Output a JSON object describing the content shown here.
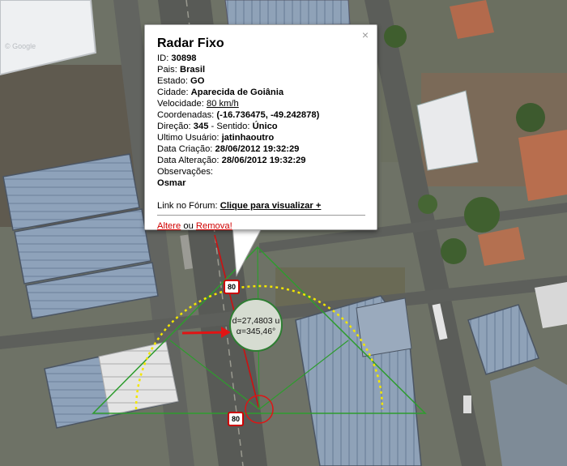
{
  "popup": {
    "title": "Radar Fixo",
    "close": "×",
    "rows": [
      {
        "label": "ID: ",
        "value": "30898"
      },
      {
        "label": "Pais: ",
        "value": "Brasil"
      },
      {
        "label": "Estado: ",
        "value": "GO"
      },
      {
        "label": "Cidade: ",
        "value": "Aparecida de Goiânia"
      },
      {
        "label": "Velocidade: ",
        "value": "80 km/h"
      },
      {
        "label": "Coordenadas: ",
        "value": "(-16.736475, -49.242878)"
      },
      {
        "label": "Direção: ",
        "value": "345",
        "label2": " - Sentido: ",
        "value2": "Único"
      },
      {
        "label": "Ultimo Usuário: ",
        "value": "jatinhaoutro"
      },
      {
        "label": "Data Criação: ",
        "value": "28/06/2012 19:32:29"
      },
      {
        "label": "Data Alteração: ",
        "value": "28/06/2012 19:32:29"
      }
    ],
    "observacoes_label": "Observações:",
    "observacoes_value": "Osmar",
    "forum_label": "Link no Fórum: ",
    "forum_link": "Clique para visualizar +",
    "edit_link": "Altere",
    "or_text": " ou ",
    "remove_link": "Remova!"
  },
  "map": {
    "speed_sign_top": "80",
    "speed_sign_bottom": "80",
    "distance_text": "d=27,4803 u",
    "angle_symbol": "α",
    "angle_text": "=345,46°",
    "watermark": "© Google"
  },
  "colors": {
    "alert_red": "#d00000",
    "guide_green": "#2e7d32",
    "arc_yellow": "#f2e600"
  }
}
